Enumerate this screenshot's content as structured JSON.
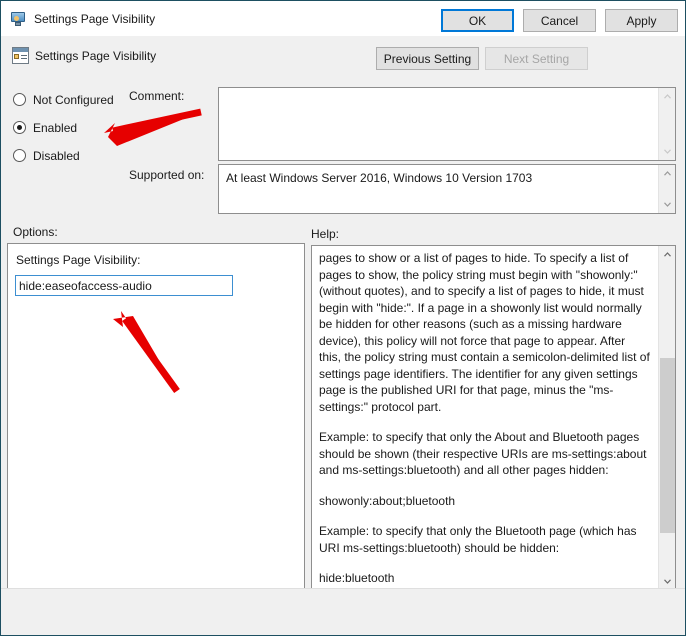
{
  "window": {
    "title": "Settings Page Visibility",
    "title_icon": "monitor-policy-icon",
    "controls": {
      "minimize": "minimize-icon",
      "maximize": "maximize-icon",
      "close": "close-icon"
    }
  },
  "header": {
    "icon": "policy-setting-icon",
    "title": "Settings Page Visibility",
    "previous_button": "Previous Setting",
    "next_button": "Next Setting"
  },
  "state_options": [
    {
      "label": "Not Configured",
      "selected": false
    },
    {
      "label": "Enabled",
      "selected": true
    },
    {
      "label": "Disabled",
      "selected": false
    }
  ],
  "comment": {
    "label": "Comment:",
    "value": ""
  },
  "supported_on": {
    "label": "Supported on:",
    "value": "At least Windows Server 2016, Windows 10 Version 1703"
  },
  "options": {
    "section_label": "Options:",
    "field_label": "Settings Page Visibility:",
    "field_value": "hide:easeofaccess-audio"
  },
  "help": {
    "section_label": "Help:",
    "paragraphs": [
      "pages to show or a list of pages to hide. To specify a list of pages to show, the policy string must begin with \"showonly:\" (without quotes), and to specify a list of pages to hide, it must begin with \"hide:\". If a page in a showonly list would normally be hidden for other reasons (such as a missing hardware device), this policy will not force that page to appear. After this, the policy string must contain a semicolon-delimited list of settings page identifiers. The identifier for any given settings page is the published URI for that page, minus the \"ms-settings:\" protocol part.",
      "Example: to specify that only the About and Bluetooth pages should be shown (their respective URIs are ms-settings:about and ms-settings:bluetooth) and all other pages hidden:",
      "showonly:about;bluetooth",
      "Example: to specify that only the Bluetooth page (which has URI ms-settings:bluetooth) should be hidden:",
      "hide:bluetooth"
    ]
  },
  "footer": {
    "ok": "OK",
    "cancel": "Cancel",
    "apply": "Apply"
  },
  "annotations": {
    "accent_color": "#e60000",
    "arrow_enabled": "arrow-pointing-to-enabled-radio",
    "arrow_field": "arrow-pointing-to-settings-page-visibility-input"
  }
}
